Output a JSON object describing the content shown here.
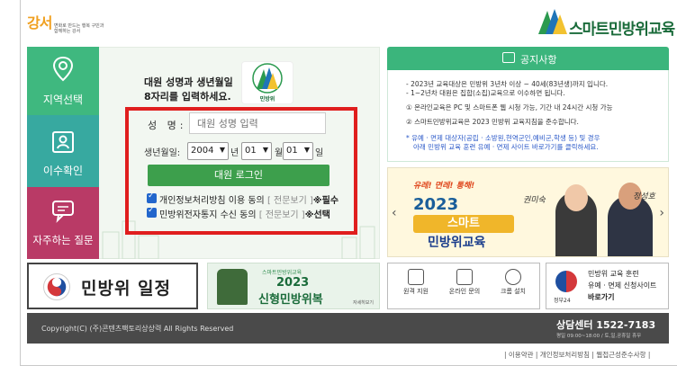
{
  "header": {
    "gangseo_logo_text": "강서",
    "gangseo_sub": "변화로 만드는 행복 구민과 함께하는 강서",
    "smart_logo_text": "스마트민방위교육"
  },
  "tabs": [
    {
      "label": "지역선택",
      "icon": "location-pin-icon"
    },
    {
      "label": "이수확인",
      "icon": "id-card-icon"
    },
    {
      "label": "자주하는 질문",
      "icon": "chat-icon"
    }
  ],
  "login": {
    "intro_line1": "대원 성명과 생년월일",
    "intro_line2": "8자리를 입력하세요.",
    "emblem_caption": "민방위",
    "name_label": "성    명:",
    "name_placeholder": "대원 성명 입력",
    "birth_label": "생년월일:",
    "year": "2004",
    "year_unit": "년",
    "month": "01",
    "month_unit": "월",
    "day": "01",
    "day_unit": "일",
    "login_button": "대원 로그인",
    "agree1_text": "개인정보처리방침 이용 동의",
    "agree1_view": "[ 전문보기 ]",
    "agree1_mark": "※필수",
    "agree2_text": "민방위전자통지 수신 동의",
    "agree2_view": "[ 전문보기 ]",
    "agree2_mark": "※선택"
  },
  "notice": {
    "title": "공지사항",
    "lines": [
      "- 2023년 교육대상은 민방위 3년차 이상 ~ 40세(83년생)까지 입니다.",
      "- 1~2년차 대원은 집합(소집)교육으로 이수하면 됩니다.",
      "① 온라인교육은 PC 및 스마트폰 웹 시청 가능, 기간 내 24시간 시청 가능",
      "② 스마트민방위교육은 2023 민방위 교육지침을 준수합니다.",
      "* 유예 · 면제 대상자(공립 · 소방원,현역군인,예비군,학생 등) 및 경우",
      "아래 민방위 교육 훈련 유예 · 면제 사이트 바로가기를 클릭하세요."
    ]
  },
  "banner": {
    "tagline": "유레! 면레! 통해!",
    "year": "2023",
    "title1": "스마트",
    "title2": "민방위교육",
    "sig1": "권미숙",
    "sig2": "정성호"
  },
  "cards": {
    "schedule": "민방위 일정",
    "uniform_small": "스마트민방위교육",
    "uniform_l1": "2023",
    "uniform_l2": "신형민방위복",
    "uniform_more": "자세히보기",
    "links": [
      {
        "label": "원격 지원"
      },
      {
        "label": "온라인 문의"
      },
      {
        "label": "크롬 설치"
      }
    ],
    "gov_t1": "민방위 교육 훈련",
    "gov_t2": "유예 · 면제 신청사이트",
    "gov_t3": "바로가기",
    "gov_label": "정부24"
  },
  "footer": {
    "copyright": "Copyright(C) (주)콘텐츠팩토리상상력 All Rights Reserved",
    "center": "상담센터  1522-7183",
    "hours": "평일 09:00~18:00 / 토,일,공휴일 휴무"
  },
  "bottom_links": "| 이용약관 | 개인정보처리방침 | 웹접근성준수사항 |"
}
